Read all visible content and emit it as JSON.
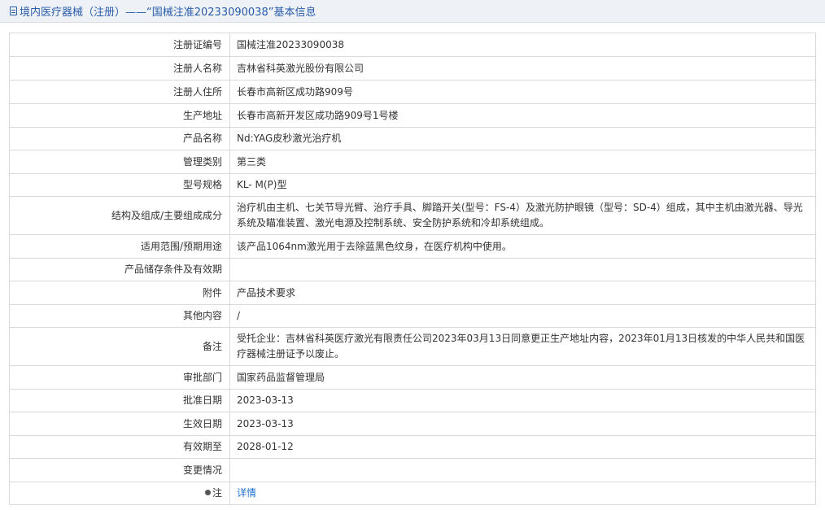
{
  "header": {
    "title": "境内医疗器械（注册）——“国械注准20233090038”基本信息",
    "icon": "document-icon"
  },
  "rows": [
    {
      "label": "注册证编号",
      "value": "国械注准20233090038"
    },
    {
      "label": "注册人名称",
      "value": "吉林省科英激光股份有限公司"
    },
    {
      "label": "注册人住所",
      "value": "长春市高新区成功路909号"
    },
    {
      "label": "生产地址",
      "value": "长春市高新开发区成功路909号1号楼"
    },
    {
      "label": "产品名称",
      "value": "Nd:YAG皮秒激光治疗机"
    },
    {
      "label": "管理类别",
      "value": "第三类"
    },
    {
      "label": "型号规格",
      "value": "KL- M(P)型"
    },
    {
      "label": "结构及组成/主要组成成分",
      "value": "治疗机由主机、七关节导光臂、治疗手具、脚踏开关(型号：FS-4）及激光防护眼镜（型号：SD-4）组成，其中主机由激光器、导光系统及瞄准装置、激光电源及控制系统、安全防护系统和冷却系统组成。"
    },
    {
      "label": "适用范围/预期用途",
      "value": "该产品1064nm激光用于去除蓝黑色纹身，在医疗机构中使用。"
    },
    {
      "label": "产品储存条件及有效期",
      "value": ""
    },
    {
      "label": "附件",
      "value": "产品技术要求"
    },
    {
      "label": "其他内容",
      "value": "/"
    },
    {
      "label": "备注",
      "value": "受托企业：吉林省科英医疗激光有限责任公司2023年03月13日同意更正生产地址内容，2023年01月13日核发的中华人民共和国医疗器械注册证予以废止。"
    },
    {
      "label": "审批部门",
      "value": "国家药品监督管理局"
    },
    {
      "label": "批准日期",
      "value": "2023-03-13"
    },
    {
      "label": "生效日期",
      "value": "2023-03-13"
    },
    {
      "label": "有效期至",
      "value": "2028-01-12"
    },
    {
      "label": "变更情况",
      "value": ""
    }
  ],
  "note": {
    "label": "注",
    "icon": "pin-icon",
    "link_text": "详情"
  }
}
